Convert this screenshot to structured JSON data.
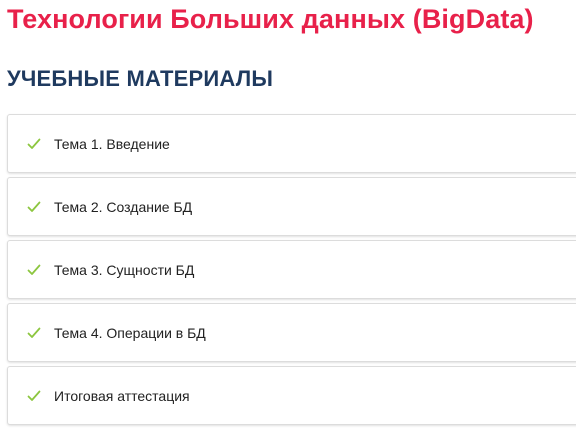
{
  "course": {
    "title": "Технологии Больших данных (BigData)"
  },
  "section": {
    "heading": "УЧЕБНЫЕ МАТЕРИАЛЫ"
  },
  "lessons": [
    {
      "label": "Тема 1. Введение",
      "icon": "check-icon"
    },
    {
      "label": "Тема 2. Создание БД",
      "icon": "check-icon"
    },
    {
      "label": "Тема 3. Сущности БД",
      "icon": "check-icon"
    },
    {
      "label": "Тема 4. Операции в БД",
      "icon": "check-icon"
    },
    {
      "label": "Итоговая аттестация",
      "icon": "check-icon"
    }
  ],
  "colors": {
    "title": "#e8214a",
    "heading": "#1f3a5f",
    "check": "#8cc63f"
  }
}
